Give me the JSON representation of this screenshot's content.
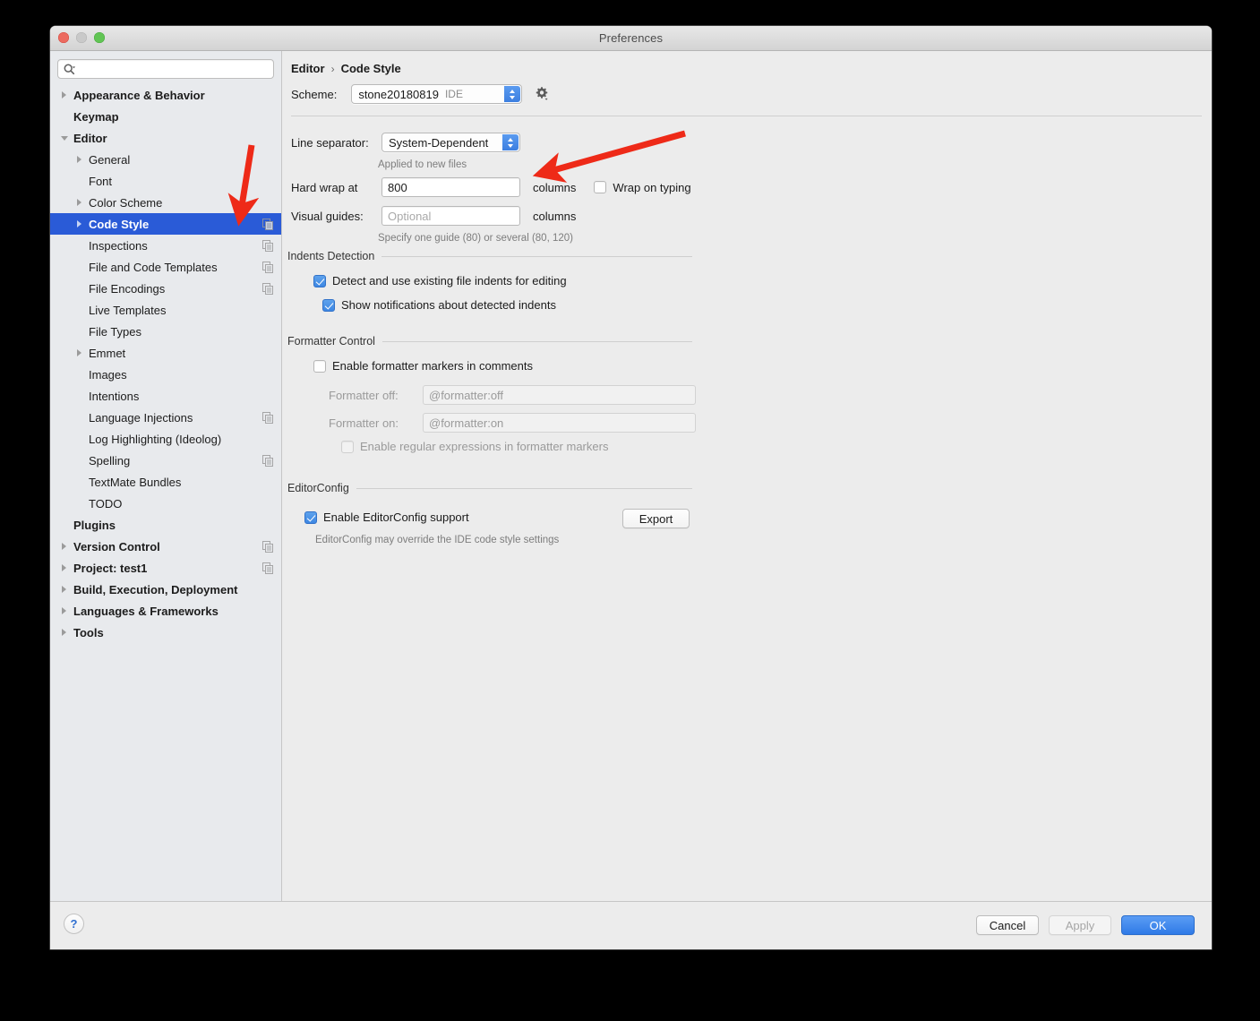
{
  "window": {
    "title": "Preferences",
    "traffic_lights": [
      "close-red",
      "minimize-gray",
      "zoom-green"
    ]
  },
  "sidebar": {
    "search": {
      "value": "",
      "placeholder": ""
    },
    "items": [
      {
        "label": "Appearance & Behavior",
        "level": 0,
        "bold": true,
        "twisty": "closed",
        "copy": false,
        "selected": false
      },
      {
        "label": "Keymap",
        "level": 0,
        "bold": true,
        "twisty": "none",
        "copy": false,
        "selected": false
      },
      {
        "label": "Editor",
        "level": 0,
        "bold": true,
        "twisty": "open",
        "copy": false,
        "selected": false
      },
      {
        "label": "General",
        "level": 1,
        "bold": false,
        "twisty": "closed",
        "copy": false,
        "selected": false
      },
      {
        "label": "Font",
        "level": 1,
        "bold": false,
        "twisty": "none",
        "copy": false,
        "selected": false
      },
      {
        "label": "Color Scheme",
        "level": 1,
        "bold": false,
        "twisty": "closed",
        "copy": false,
        "selected": false
      },
      {
        "label": "Code Style",
        "level": 1,
        "bold": false,
        "twisty": "closed",
        "copy": true,
        "selected": true
      },
      {
        "label": "Inspections",
        "level": 1,
        "bold": false,
        "twisty": "none",
        "copy": true,
        "selected": false
      },
      {
        "label": "File and Code Templates",
        "level": 1,
        "bold": false,
        "twisty": "none",
        "copy": true,
        "selected": false
      },
      {
        "label": "File Encodings",
        "level": 1,
        "bold": false,
        "twisty": "none",
        "copy": true,
        "selected": false
      },
      {
        "label": "Live Templates",
        "level": 1,
        "bold": false,
        "twisty": "none",
        "copy": false,
        "selected": false
      },
      {
        "label": "File Types",
        "level": 1,
        "bold": false,
        "twisty": "none",
        "copy": false,
        "selected": false
      },
      {
        "label": "Emmet",
        "level": 1,
        "bold": false,
        "twisty": "closed",
        "copy": false,
        "selected": false
      },
      {
        "label": "Images",
        "level": 1,
        "bold": false,
        "twisty": "none",
        "copy": false,
        "selected": false
      },
      {
        "label": "Intentions",
        "level": 1,
        "bold": false,
        "twisty": "none",
        "copy": false,
        "selected": false
      },
      {
        "label": "Language Injections",
        "level": 1,
        "bold": false,
        "twisty": "none",
        "copy": true,
        "selected": false
      },
      {
        "label": "Log Highlighting (Ideolog)",
        "level": 1,
        "bold": false,
        "twisty": "none",
        "copy": false,
        "selected": false
      },
      {
        "label": "Spelling",
        "level": 1,
        "bold": false,
        "twisty": "none",
        "copy": true,
        "selected": false
      },
      {
        "label": "TextMate Bundles",
        "level": 1,
        "bold": false,
        "twisty": "none",
        "copy": false,
        "selected": false
      },
      {
        "label": "TODO",
        "level": 1,
        "bold": false,
        "twisty": "none",
        "copy": false,
        "selected": false
      },
      {
        "label": "Plugins",
        "level": 0,
        "bold": true,
        "twisty": "none",
        "copy": false,
        "selected": false
      },
      {
        "label": "Version Control",
        "level": 0,
        "bold": true,
        "twisty": "closed",
        "copy": true,
        "selected": false
      },
      {
        "label": "Project: test1",
        "level": 0,
        "bold": true,
        "twisty": "closed",
        "copy": true,
        "selected": false
      },
      {
        "label": "Build, Execution, Deployment",
        "level": 0,
        "bold": true,
        "twisty": "closed",
        "copy": false,
        "selected": false
      },
      {
        "label": "Languages & Frameworks",
        "level": 0,
        "bold": true,
        "twisty": "closed",
        "copy": false,
        "selected": false
      },
      {
        "label": "Tools",
        "level": 0,
        "bold": true,
        "twisty": "closed",
        "copy": false,
        "selected": false
      }
    ]
  },
  "main": {
    "breadcrumb": {
      "parent": "Editor",
      "separator": "›",
      "current": "Code Style"
    },
    "scheme": {
      "label": "Scheme:",
      "value": "stone20180819",
      "scope": "IDE"
    },
    "line_separator": {
      "label": "Line separator:",
      "value": "System-Dependent",
      "hint": "Applied to new files"
    },
    "hard_wrap": {
      "label": "Hard wrap at",
      "value": "800",
      "unit": "columns"
    },
    "wrap_on_typing": {
      "label": "Wrap on typing",
      "checked": false
    },
    "visual_guides": {
      "label": "Visual guides:",
      "value": "",
      "placeholder": "Optional",
      "unit": "columns",
      "hint": "Specify one guide (80) or several (80, 120)"
    },
    "indents_detection": {
      "title": "Indents Detection",
      "detect": {
        "label": "Detect and use existing file indents for editing",
        "checked": true
      },
      "notify": {
        "label": "Show notifications about detected indents",
        "checked": true
      }
    },
    "formatter_control": {
      "title": "Formatter Control",
      "enable_markers": {
        "label": "Enable formatter markers in comments",
        "checked": false
      },
      "off": {
        "label": "Formatter off:",
        "value": "@formatter:off",
        "disabled": true
      },
      "on": {
        "label": "Formatter on:",
        "value": "@formatter:on",
        "disabled": true
      },
      "regex": {
        "label": "Enable regular expressions in formatter markers",
        "checked": false,
        "disabled": true
      }
    },
    "editorconfig": {
      "title": "EditorConfig",
      "enable": {
        "label": "Enable EditorConfig support",
        "checked": true
      },
      "export_label": "Export",
      "hint": "EditorConfig may override the IDE code style settings"
    }
  },
  "footer": {
    "help_label": "?",
    "cancel_label": "Cancel",
    "apply_label": "Apply",
    "apply_disabled": true,
    "ok_label": "OK"
  },
  "annotations": {
    "arrow_color": "#ee2a18",
    "arrows": [
      {
        "name": "arrow-to-code-style",
        "from": [
          281,
          162
        ],
        "to": [
          269,
          236
        ]
      },
      {
        "name": "arrow-to-hard-wrap",
        "from": [
          765,
          149
        ],
        "to": [
          611,
          192
        ]
      }
    ]
  },
  "colors": {
    "selection_blue": "#2a5bd7",
    "accent_blue": "#3d87e3",
    "window_bg": "#ececec",
    "sidebar_bg": "#e8eaed"
  }
}
